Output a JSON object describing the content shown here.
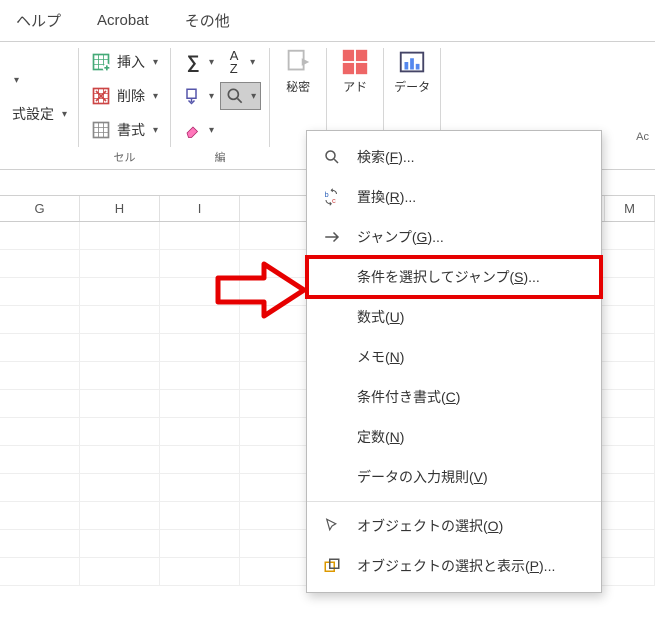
{
  "tabs": {
    "help": "ヘルプ",
    "acrobat": "Acrobat",
    "other": "その他"
  },
  "left": {
    "fmt_setting": "式設定",
    "chev": "﹀"
  },
  "cells_group": {
    "insert": "挿入",
    "delete": "削除",
    "format": "書式",
    "label": "セル"
  },
  "editing_group": {
    "label": "編"
  },
  "big": {
    "secret": "秘密",
    "ad": "アド",
    "data": "データ"
  },
  "addins_label": "Ac",
  "cols": [
    "G",
    "H",
    "I",
    "M"
  ],
  "menu": {
    "find": "検索(F)...",
    "replace": "置換(R)...",
    "goto": "ジャンプ(G)...",
    "goto_special": "条件を選択してジャンプ(S)...",
    "formulas": "数式(U)",
    "notes": "メモ(N)",
    "cond_fmt": "条件付き書式(C)",
    "constants": "定数(N)",
    "data_valid": "データの入力規則(V)",
    "sel_obj": "オブジェクトの選択(O)",
    "sel_pane": "オブジェクトの選択と表示(P)..."
  }
}
